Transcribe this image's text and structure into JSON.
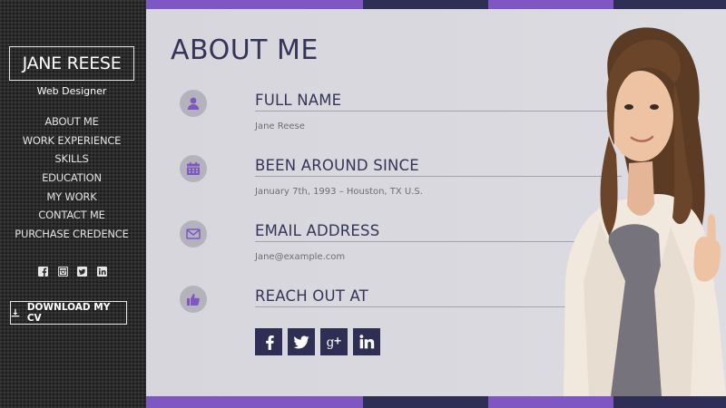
{
  "sidebar": {
    "name": "JANE REESE",
    "role": "Web Designer",
    "nav": [
      {
        "label": "ABOUT ME"
      },
      {
        "label": "WORK EXPERIENCE"
      },
      {
        "label": "SKILLS"
      },
      {
        "label": "EDUCATION"
      },
      {
        "label": "MY WORK"
      },
      {
        "label": "CONTACT ME"
      },
      {
        "label": "PURCHASE CREDENCE"
      }
    ],
    "social_icons": [
      "facebook-icon",
      "instagram-icon",
      "twitter-icon",
      "linkedin-icon"
    ],
    "download_label": "DOWNLOAD MY CV",
    "download_icon": "download-icon"
  },
  "main": {
    "title": "ABOUT ME",
    "sections": [
      {
        "icon": "user-icon",
        "label": "FULL NAME",
        "value": "Jane Reese"
      },
      {
        "icon": "calendar-icon",
        "label": "BEEN AROUND SINCE",
        "value": "January 7th, 1993 – Houston, TX U.S."
      },
      {
        "icon": "envelope-icon",
        "label": "EMAIL ADDRESS",
        "value": "Jane@example.com"
      },
      {
        "icon": "thumbs-up-icon",
        "label": "REACH OUT AT",
        "value": ""
      }
    ],
    "share_icons": [
      "facebook-icon",
      "twitter-icon",
      "google-plus-icon",
      "linkedin-icon"
    ]
  },
  "colors": {
    "sidebar_bg": "#2b2b2b",
    "accent_purple": "#7e57c2",
    "navy": "#2f2f55",
    "title_text": "#35355a",
    "icon_circle": "#b4b3bd",
    "main_bg": "#d7d7dd"
  }
}
